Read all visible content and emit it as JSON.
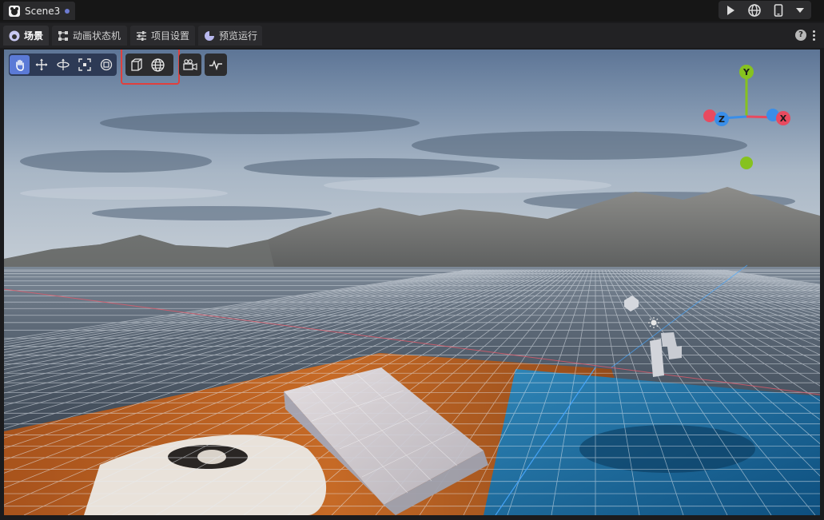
{
  "window": {
    "scene_tab_label": "Scene3"
  },
  "panel_tabs": [
    {
      "label": "场景",
      "icon": "scene-icon",
      "active": true
    },
    {
      "label": "动画状态机",
      "icon": "state-machine-icon",
      "active": false
    },
    {
      "label": "项目设置",
      "icon": "sliders-icon",
      "active": false
    },
    {
      "label": "预览运行",
      "icon": "preview-icon",
      "active": false
    }
  ],
  "run_controls": [
    "play-icon",
    "globe-icon",
    "mobile-icon",
    "dropdown-icon"
  ],
  "toolbar": {
    "transform_tools": [
      "hand-icon",
      "move-icon",
      "rotate-icon",
      "scale-icon",
      "rect-icon"
    ],
    "view_tools": [
      "camera-view-icon",
      "globe-icon"
    ],
    "extra_tools": [
      "camera-icon",
      "stats-icon"
    ]
  },
  "gizmo": {
    "y_label": "Y",
    "x_label": "X",
    "z_label": "Z"
  },
  "colors": {
    "highlight": "#e0403d",
    "axis_x": "#e84a5f",
    "axis_y": "#86c21f",
    "axis_z": "#3a8ee8",
    "active_tool": "#5b7ad6"
  }
}
